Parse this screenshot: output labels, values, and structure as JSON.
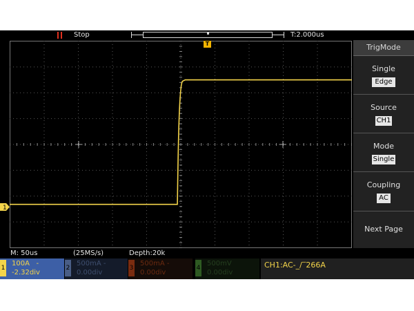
{
  "status": {
    "run_state": "Stop",
    "timebase_position": "T:2.000us"
  },
  "menu": {
    "title": "TrigMode",
    "items": [
      {
        "label": "Single",
        "value": "Edge"
      },
      {
        "label": "Source",
        "value": "CH1"
      },
      {
        "label": "Mode",
        "value": "Single"
      },
      {
        "label": "Coupling",
        "value": "AC"
      },
      {
        "label": "Next Page",
        "value": ""
      }
    ]
  },
  "info": {
    "timebase": "M: 50us",
    "sample_rate": "(25MS/s)",
    "depth": "Depth:20k"
  },
  "channels": [
    {
      "number": "1",
      "scale": "100A",
      "coupling_mark": "-",
      "offset": "-2.32div"
    },
    {
      "number": "2",
      "scale": "500mA",
      "coupling_mark": "-",
      "offset": "0.00div"
    },
    {
      "number": "3",
      "scale": "500mA",
      "coupling_mark": "-",
      "offset": "0.00div"
    },
    {
      "number": "4",
      "scale": "500mV",
      "coupling_mark": "",
      "offset": "0.00div"
    }
  ],
  "trigger_info": "CH1:AC-_/‾266A",
  "markers": {
    "trigger": "T",
    "ch1": "1"
  },
  "colors": {
    "ch1": "#f4d44a",
    "ch2": "#4a5e86",
    "ch3": "#7a2c10",
    "ch4": "#2e5a22",
    "run_indicator": "#e0301e",
    "grid": "#5a5a5a",
    "background": "#000000"
  },
  "waveform_ch1": {
    "description_units": "div",
    "low_level_div": -2.32,
    "high_level_div": 2.5,
    "edge_time_div": -0.1,
    "rise_time_div": 0.15
  }
}
